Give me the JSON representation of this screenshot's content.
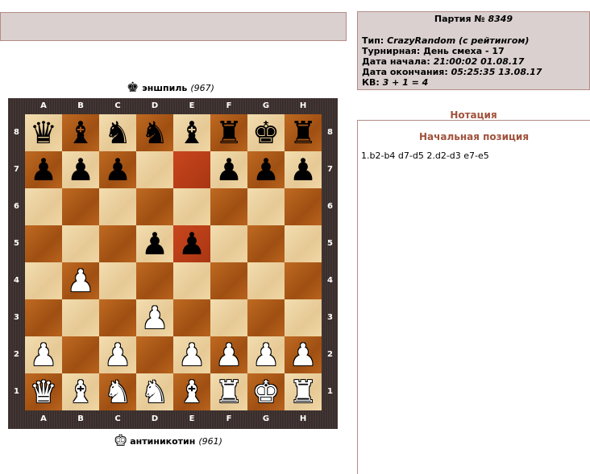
{
  "info": {
    "title_prefix": "Партия №",
    "game_number": "8349",
    "type_label": "Тип:",
    "type_value": "CrazyRandom (с рейтингом)",
    "tournament_label": "Турнирная:",
    "tournament_value": "День смеха - 17",
    "start_label": "Дата начала:",
    "start_value": "21:00:02 01.08.17",
    "end_label": "Дата окончания:",
    "end_value": "05:25:35 13.08.17",
    "kv_label": "КВ:",
    "kv_value": "3 + 1 = 4"
  },
  "notation": {
    "header": "Нотация",
    "start_position": "Начальная позиция",
    "moves": "1.b2-b4 d7-d5 2.d2-d3 e7-e5"
  },
  "players": {
    "top": {
      "name": "эншпиль",
      "rating": "(967)",
      "icon": "black-king-icon"
    },
    "bottom": {
      "name": "антиникотин",
      "rating": "(961)",
      "icon": "white-king-icon"
    }
  },
  "board": {
    "files": [
      "A",
      "B",
      "C",
      "D",
      "E",
      "F",
      "G",
      "H"
    ],
    "ranks": [
      "8",
      "7",
      "6",
      "5",
      "4",
      "3",
      "2",
      "1"
    ],
    "highlight": [
      "e7",
      "e5"
    ],
    "position": [
      [
        "bq",
        "bb",
        "bn",
        "bn",
        "bb",
        "br",
        "bk",
        "br"
      ],
      [
        "bp",
        "bp",
        "bp",
        "",
        "",
        "bp",
        "bp",
        "bp"
      ],
      [
        "",
        "",
        "",
        "",
        "",
        "",
        "",
        ""
      ],
      [
        "",
        "",
        "",
        "bp",
        "bp",
        "",
        "",
        ""
      ],
      [
        "",
        "wp",
        "",
        "",
        "",
        "",
        "",
        ""
      ],
      [
        "",
        "",
        "",
        "wp",
        "",
        "",
        "",
        ""
      ],
      [
        "wp",
        "",
        "wp",
        "",
        "wp",
        "wp",
        "wp",
        "wp"
      ],
      [
        "wq",
        "wb",
        "wn",
        "wn",
        "wb",
        "wr",
        "wk",
        "wr"
      ]
    ]
  }
}
